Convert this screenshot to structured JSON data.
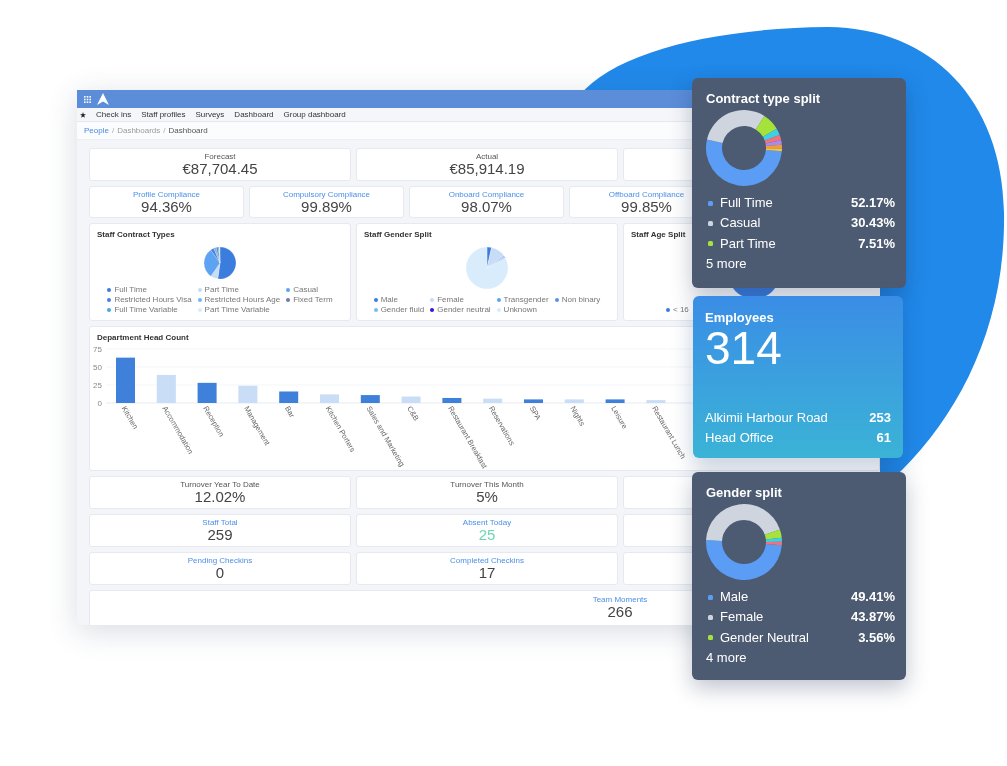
{
  "dashboard": {
    "nav_items": [
      "Check ins",
      "Staff profiles",
      "Surveys",
      "Dashboard",
      "Group dashboard"
    ],
    "breadcrumb": {
      "items": [
        "People",
        "Dashboards",
        "Dashboard"
      ],
      "separator": "/"
    },
    "summary_cards": [
      {
        "label": "Forecast",
        "value": "€87,704.45",
        "accent": false
      },
      {
        "label": "Actual",
        "value": "€85,914.19",
        "accent": false
      }
    ],
    "compliance_cards": [
      {
        "label": "Profile Compliance",
        "value": "94.36%",
        "accent": true
      },
      {
        "label": "Compulsory Compliance",
        "value": "99.89%",
        "accent": true
      },
      {
        "label": "Onboard Compliance",
        "value": "98.07%",
        "accent": true
      },
      {
        "label": "Offboard Compliance",
        "value": "99.85%",
        "accent": true
      }
    ],
    "pie_charts": [
      {
        "title": "Staff Contract Types",
        "legend": [
          {
            "label": "Full Time",
            "color": "#3b7ddd"
          },
          {
            "label": "Part Time",
            "color": "#c8dcf5"
          },
          {
            "label": "Casual",
            "color": "#5ea3f2"
          },
          {
            "label": "Restricted Hours Visa",
            "color": "#4b7fe0"
          },
          {
            "label": "Restricted Hours Age",
            "color": "#72b4f2"
          },
          {
            "label": "Fixed Term",
            "color": "#6b7fa0"
          },
          {
            "label": "Full Time Variable",
            "color": "#45a6e6"
          },
          {
            "label": "Part Time Variable",
            "color": "#d9ecfb"
          }
        ]
      },
      {
        "title": "Staff Gender Split",
        "legend": [
          {
            "label": "Male",
            "color": "#3b7ddd"
          },
          {
            "label": "Female",
            "color": "#c8dcf5"
          },
          {
            "label": "Transgender",
            "color": "#5ea3f2"
          },
          {
            "label": "Non binary",
            "color": "#5b8ef0"
          },
          {
            "label": "Gender fluid",
            "color": "#72bdf2"
          },
          {
            "label": "Gender neutral",
            "color": "#2a19e0"
          },
          {
            "label": "Unknown",
            "color": "#d9ecfb"
          }
        ]
      },
      {
        "title": "Staff Age Split",
        "legend": [
          {
            "label": "< 16",
            "color": "#3b7ddd"
          }
        ]
      }
    ],
    "department_head_count": {
      "bar_fills": [
        {
          "color": "#3f80da"
        },
        {
          "color": "#c9ddf6"
        }
      ],
      "chart_data": {
        "type": "bar",
        "title": "Department Head Count",
        "categories": [
          "Kitchen",
          "Accommodation",
          "Reception",
          "Management",
          "Bar",
          "Kitchen Porters",
          "Sales and Marketing",
          "C&B",
          "Restaurant Breakfast",
          "Reservations",
          "SPA",
          "Nights",
          "Leisure",
          "Restaurant Lunch"
        ],
        "values": [
          63,
          39,
          28,
          24,
          16,
          12,
          11,
          9,
          7,
          6,
          5,
          5,
          5,
          4
        ],
        "ylim": [
          0,
          75
        ],
        "yticks": [
          0,
          25,
          50,
          75
        ]
      }
    },
    "turnover_cards": [
      {
        "label": "Turnover Year To Date",
        "value": "12.02%",
        "accent": false
      },
      {
        "label": "Turnover This Month",
        "value": "5%",
        "accent": false
      }
    ],
    "staff_cards": [
      {
        "label": "Staff Total",
        "value": "259",
        "accent": true
      },
      {
        "label": "Absent Today",
        "value": "25",
        "accent": true,
        "color": "#6bd6b1"
      }
    ],
    "checkin_cards": [
      {
        "label": "Pending Checkins",
        "value": "0",
        "accent": true
      },
      {
        "label": "Completed Checkins",
        "value": "17",
        "accent": true
      }
    ],
    "team_moments": {
      "label": "Team Moments",
      "value": "266",
      "accent": true
    }
  },
  "contract_type_split": {
    "chart_data": {
      "type": "donut",
      "title": "Contract type split",
      "values": [
        52.17,
        30.43,
        7.51,
        2.9,
        2.3,
        1.9,
        1.6,
        1.19
      ]
    },
    "legend": [
      {
        "label": "Full Time",
        "value": "52.17%",
        "color": "#5b9df5"
      },
      {
        "label": "Casual",
        "value": "30.43%",
        "color": "#cfd5de"
      },
      {
        "label": "Part Time",
        "value": "7.51%",
        "color": "#a6e33a"
      }
    ],
    "other_slices": [
      {
        "color": "#3fd0e6"
      },
      {
        "color": "#f0727c"
      },
      {
        "color": "#a98bf0"
      },
      {
        "color": "#f39a3c"
      },
      {
        "color": "#f5c542"
      }
    ],
    "more": "5 more"
  },
  "employees": {
    "title": "Employees",
    "total": "314",
    "sites": [
      {
        "name": "Alkimii Harbour Road",
        "count": "253"
      },
      {
        "name": "Head Office",
        "count": "61"
      }
    ]
  },
  "gender_split": {
    "chart_data": {
      "type": "donut",
      "title": "Gender split",
      "values": [
        49.41,
        43.87,
        3.56,
        1.7,
        1.46
      ]
    },
    "legend": [
      {
        "label": "Male",
        "value": "49.41%",
        "color": "#5b9df5"
      },
      {
        "label": "Female",
        "value": "43.87%",
        "color": "#cfd5de"
      },
      {
        "label": "Gender Neutral",
        "value": "3.56%",
        "color": "#a6e33a"
      }
    ],
    "other_slices": [
      {
        "color": "#3fd0e6"
      },
      {
        "color": "#f0727c"
      }
    ],
    "more": "4 more"
  }
}
